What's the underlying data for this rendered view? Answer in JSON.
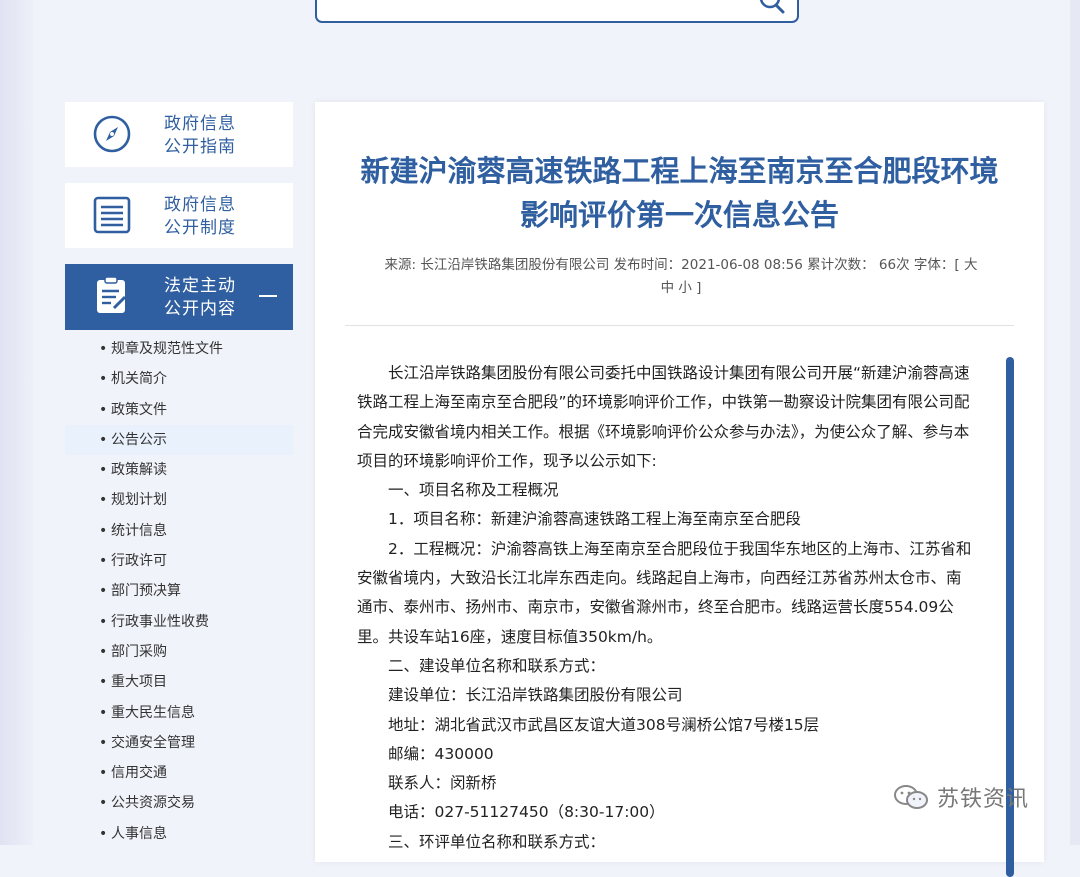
{
  "colors": {
    "accent": "#2f5fa0",
    "selected_bg": "#e8f1fc"
  },
  "search": {
    "icon": "search-icon"
  },
  "sidebar": {
    "cards": [
      {
        "line1": "政府信息",
        "line2": "公开指南",
        "icon": "compass-icon"
      },
      {
        "line1": "政府信息",
        "line2": "公开制度",
        "icon": "list-icon"
      },
      {
        "line1": "法定主动",
        "line2": "公开内容",
        "icon": "document-edit-icon",
        "toggle": "—"
      }
    ],
    "bullet": "•",
    "items": [
      "规章及规范性文件",
      "机关简介",
      "政策文件",
      "公告公示",
      "政策解读",
      "规划计划",
      "统计信息",
      "行政许可",
      "部门预决算",
      "行政事业性收费",
      "部门采购",
      "重大项目",
      "重大民生信息",
      "交通安全管理",
      "信用交通",
      "公共资源交易",
      "人事信息"
    ],
    "selected_index": 3
  },
  "article": {
    "title_line1": "新建沪渝蓉高速铁路工程上海至南京至合肥段环境",
    "title_line2": "影响评价第一次信息公告",
    "meta_line1": "来源: 长江沿岸铁路集团股份有限公司  发布时间：2021-06-08 08:56  累计次数： 66次  字体：[ 大",
    "meta_line2": "中 小 ]",
    "paragraphs": [
      {
        "text": "长江沿岸铁路集团股份有限公司委托中国铁路设计集团有限公司开展“新建沪渝蓉高速铁路工程上海至南京至合肥段”的环境影响评价工作，中铁第一勘察设计院集团有限公司配合完成安徽省境内相关工作。根据《环境影响评价公众参与办法》，为使公众了解、参与本项目的环境影响评价工作，现予以公示如下:"
      },
      {
        "text": "一、项目名称及工程概况"
      },
      {
        "text": "1．项目名称：新建沪渝蓉高速铁路工程上海至南京至合肥段"
      },
      {
        "text": "2．工程概况：沪渝蓉高铁上海至南京至合肥段位于我国华东地区的上海市、江苏省和安徽省境内，大致沿长江北岸东西走向。线路起自上海市，向西经江苏省苏州太仓市、南通市、泰州市、扬州市、南京市，安徽省滁州市，终至合肥市。线路运营长度554.09公里。共设车站16座，速度目标值350km/h。"
      },
      {
        "text": "二、建设单位名称和联系方式："
      },
      {
        "text": "建设单位：长江沿岸铁路集团股份有限公司"
      },
      {
        "text": "地址：湖北省武汉市武昌区友谊大道308号澜桥公馆7号楼15层"
      },
      {
        "text": "邮编：430000"
      },
      {
        "text": "联系人：闵新桥"
      },
      {
        "text": "电话：027-51127450（8:30-17:00）"
      },
      {
        "text": "三、环评单位名称和联系方式："
      }
    ]
  },
  "watermark": {
    "text": "苏铁资讯",
    "icon": "wechat-icon"
  }
}
